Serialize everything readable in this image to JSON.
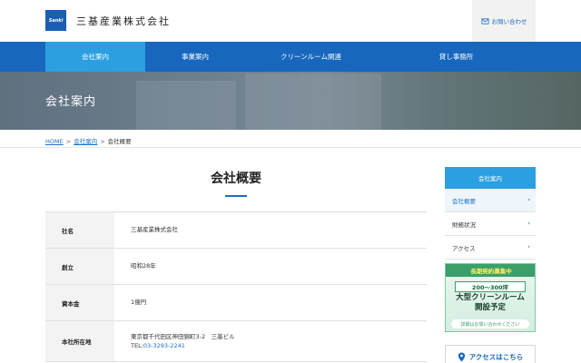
{
  "header": {
    "logo_text": "Sanki",
    "company_name": "三基産業株式会社",
    "contact_label": "お問い合わせ",
    "contact_icon": "mail-icon"
  },
  "nav": {
    "items": [
      {
        "label": "会社案内",
        "active": true
      },
      {
        "label": "事業案内",
        "active": false
      },
      {
        "label": "クリーンルーム関連",
        "active": false
      },
      {
        "label": "貸し事務所",
        "active": false
      }
    ]
  },
  "hero": {
    "title": "会社案内"
  },
  "breadcrumb": {
    "home": "HOME",
    "section": "会社案内",
    "current": "会社概要",
    "separator": ">"
  },
  "main": {
    "title": "会社概要",
    "rows": [
      {
        "label": "社名",
        "value": "三基産業株式会社"
      },
      {
        "label": "創立",
        "value": "昭和28年"
      },
      {
        "label": "資本金",
        "value": "1億円"
      },
      {
        "label": "本社所在地",
        "value": "東京都千代田区神田錦町3-2　三基ビル",
        "tel_label": "TEL:",
        "tel": "03-3293-2241"
      }
    ]
  },
  "sidebar": {
    "header": "会社案内",
    "items": [
      {
        "label": "会社概要",
        "active": true
      },
      {
        "label": "財務状況",
        "active": false
      },
      {
        "label": "アクセス",
        "active": false
      }
    ],
    "chevron": "›"
  },
  "banner": {
    "tag": "長期契約募集中",
    "size": "200〜300坪",
    "main_line1": "大型クリーンルーム",
    "main_line2": "開設予定",
    "sub": "詳細はお問い合わせください"
  },
  "access": {
    "label": "アクセスはこちら",
    "icon": "map-pin-icon"
  },
  "colors": {
    "brand_blue": "#1667bd",
    "accent_blue": "#2b9fe0",
    "link_blue": "#1a6fc4",
    "banner_green": "#3a9f6a"
  }
}
